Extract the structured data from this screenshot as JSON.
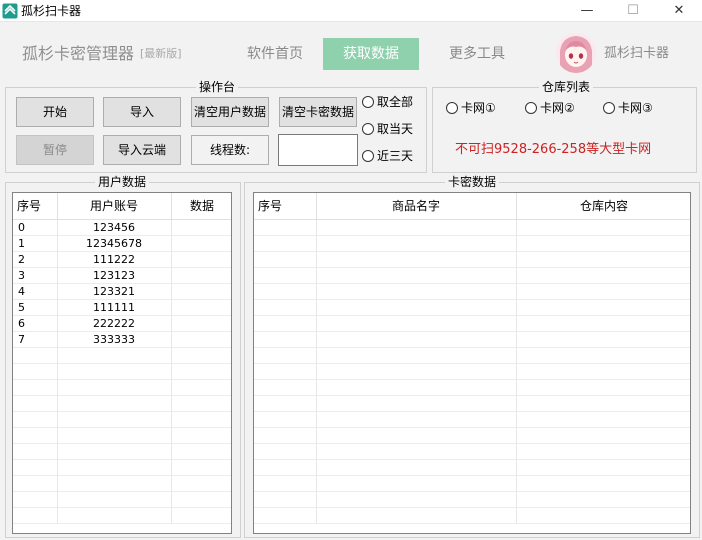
{
  "window": {
    "title": "孤杉扫卡器",
    "controls": {
      "minimize": "—",
      "maximize": "☐",
      "close": "✕"
    }
  },
  "header": {
    "brand": "孤杉卡密管理器",
    "brand_sub": "[最新版]",
    "nav": [
      {
        "label": "软件首页",
        "active": false
      },
      {
        "label": "获取数据",
        "active": true
      },
      {
        "label": "更多工具",
        "active": false
      }
    ],
    "user_name": "孤杉扫卡器",
    "accent_color": "#8fd0ad"
  },
  "ops": {
    "title": "操作台",
    "start": "开始",
    "import": "导入",
    "clear_users": "清空用户数据",
    "clear_cards": "清空卡密数据",
    "pause": "暂停",
    "import_cloud": "导入云端",
    "threads_label": "线程数:",
    "threads_value": "",
    "radios": [
      "取全部",
      "取当天",
      "近三天"
    ]
  },
  "repo": {
    "title": "仓库列表",
    "options": [
      "卡网①",
      "卡网②",
      "卡网③"
    ],
    "notice": "不可扫9528-266-258等大型卡网",
    "notice_color": "#cc2222"
  },
  "users": {
    "title": "用户数据",
    "columns": [
      "序号",
      "用户账号",
      "数据"
    ],
    "rows": [
      [
        "0",
        "123456",
        ""
      ],
      [
        "1",
        "12345678",
        ""
      ],
      [
        "2",
        "111222",
        ""
      ],
      [
        "3",
        "123123",
        ""
      ],
      [
        "4",
        "123321",
        ""
      ],
      [
        "5",
        "111111",
        ""
      ],
      [
        "6",
        "222222",
        ""
      ],
      [
        "7",
        "333333",
        ""
      ]
    ]
  },
  "cards": {
    "title": "卡密数据",
    "columns": [
      "序号",
      "商品名字",
      "仓库内容"
    ],
    "rows": []
  }
}
